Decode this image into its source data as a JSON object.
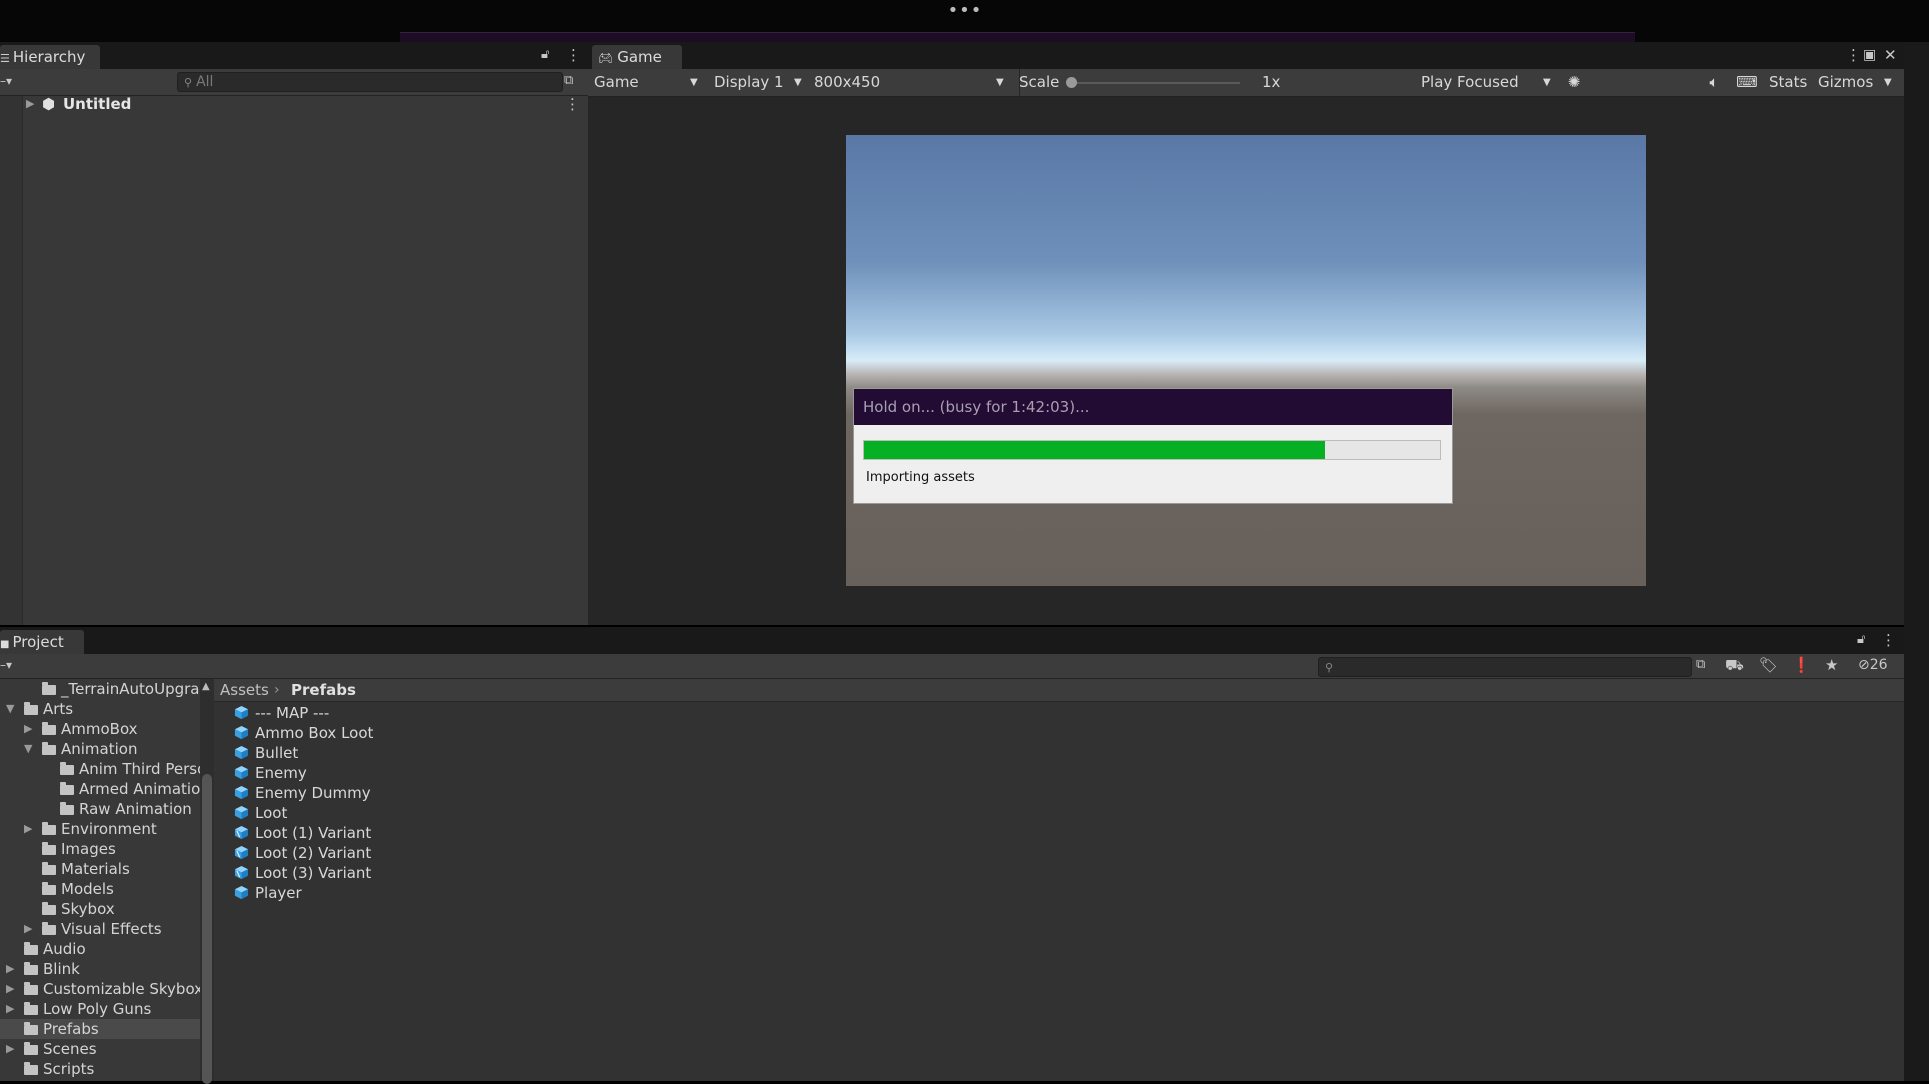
{
  "hierarchy": {
    "tab_label": "Hierarchy",
    "search_placeholder": "All",
    "scene_name": "Untitled"
  },
  "game": {
    "tab_label": "Game",
    "view_mode": "Game",
    "display": "Display 1",
    "resolution": "800x450",
    "scale_label": "Scale",
    "scale_value": "1x",
    "play_mode": "Play Focused",
    "stats_label": "Stats",
    "gizmos_label": "Gizmos"
  },
  "progress_dialog": {
    "title": "Hold on... (busy for 1:42:03)...",
    "progress": 0.8,
    "status": "Importing assets",
    "colors": {
      "fill": "#06b025",
      "title_bg": "#230c33"
    }
  },
  "project": {
    "tab_label": "Project",
    "hidden_count": "26",
    "breadcrumb": {
      "root": "Assets",
      "current": "Prefabs"
    },
    "tree": [
      {
        "label": "_TerrainAutoUpgrade",
        "depth": 1,
        "arrow": ""
      },
      {
        "label": "Arts",
        "depth": 0,
        "arrow": "open"
      },
      {
        "label": "AmmoBox",
        "depth": 1,
        "arrow": "closed"
      },
      {
        "label": "Animation",
        "depth": 1,
        "arrow": "open"
      },
      {
        "label": "Anim Third Perso",
        "depth": 2,
        "arrow": ""
      },
      {
        "label": "Armed Animation",
        "depth": 2,
        "arrow": ""
      },
      {
        "label": "Raw Animation",
        "depth": 2,
        "arrow": ""
      },
      {
        "label": "Environment",
        "depth": 1,
        "arrow": "closed"
      },
      {
        "label": "Images",
        "depth": 1,
        "arrow": ""
      },
      {
        "label": "Materials",
        "depth": 1,
        "arrow": ""
      },
      {
        "label": "Models",
        "depth": 1,
        "arrow": ""
      },
      {
        "label": "Skybox",
        "depth": 1,
        "arrow": ""
      },
      {
        "label": "Visual Effects",
        "depth": 1,
        "arrow": "closed"
      },
      {
        "label": "Audio",
        "depth": 0,
        "arrow": ""
      },
      {
        "label": "Blink",
        "depth": 0,
        "arrow": "closed"
      },
      {
        "label": "Customizable Skybox",
        "depth": 0,
        "arrow": "closed"
      },
      {
        "label": "Low Poly Guns",
        "depth": 0,
        "arrow": "closed"
      },
      {
        "label": "Prefabs",
        "depth": 0,
        "arrow": "",
        "selected": true
      },
      {
        "label": "Scenes",
        "depth": 0,
        "arrow": "closed"
      },
      {
        "label": "Scripts",
        "depth": 0,
        "arrow": ""
      }
    ],
    "assets": [
      {
        "label": "--- MAP ---",
        "variant": false
      },
      {
        "label": "Ammo Box Loot",
        "variant": false
      },
      {
        "label": "Bullet",
        "variant": false
      },
      {
        "label": "Enemy",
        "variant": false
      },
      {
        "label": "Enemy Dummy",
        "variant": false
      },
      {
        "label": "Loot",
        "variant": false
      },
      {
        "label": "Loot (1) Variant",
        "variant": true
      },
      {
        "label": "Loot (2) Variant",
        "variant": true
      },
      {
        "label": "Loot (3) Variant",
        "variant": true
      },
      {
        "label": "Player",
        "variant": false
      }
    ]
  }
}
